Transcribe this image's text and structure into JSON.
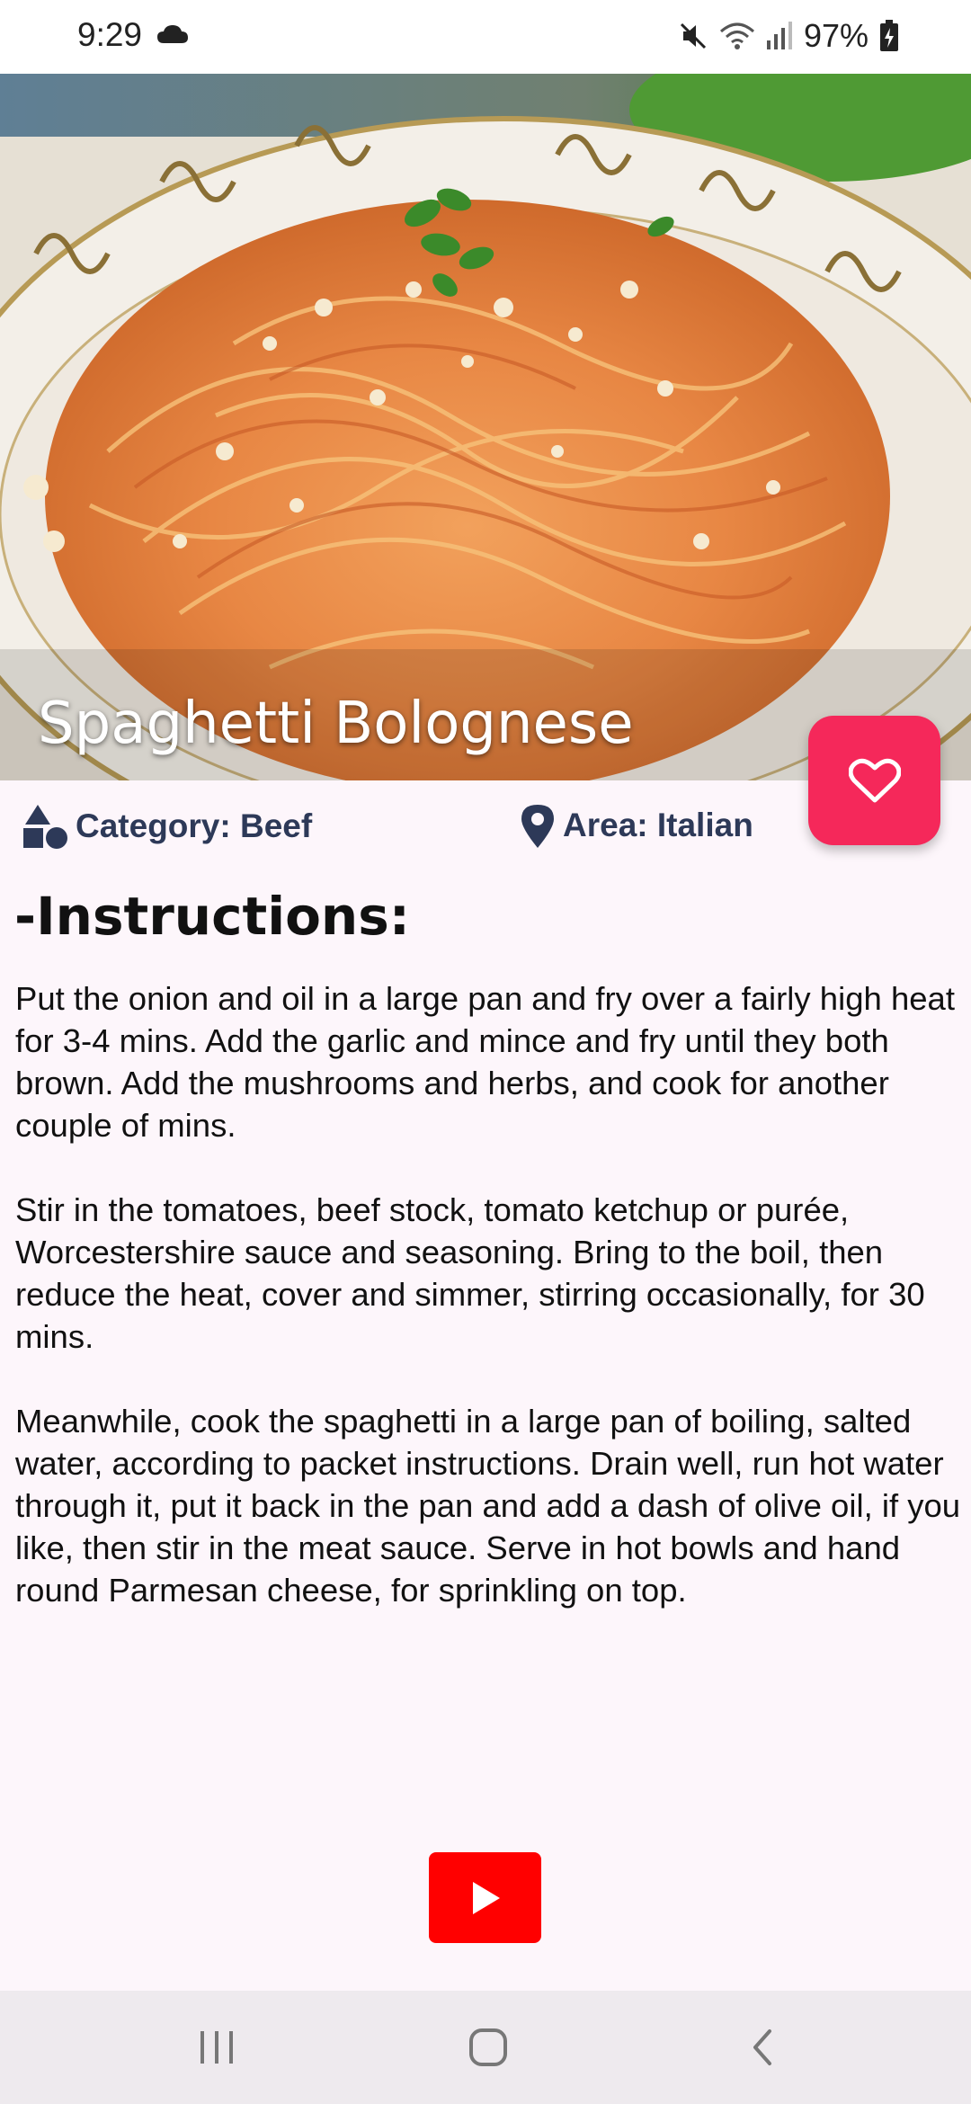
{
  "status_bar": {
    "time": "9:29",
    "battery": "97%",
    "icons": [
      "cloud-icon",
      "mute-icon",
      "wifi-icon",
      "signal-icon",
      "battery-icon"
    ]
  },
  "recipe": {
    "title": "Spaghetti Bolognese",
    "category": "Category: Beef",
    "area": "Area: Italian",
    "instructions_heading": "-Instructions:",
    "instructions": [
      "Put the onion and oil in a large pan and fry over a fairly high heat for 3-4 mins. Add the garlic and mince and fry until they both brown. Add the mushrooms and herbs, and cook for another couple of mins.",
      "Stir in the tomatoes, beef stock, tomato ketchup or purée, Worcestershire sauce and seasoning. Bring to the boil, then reduce the heat, cover and simmer, stirring occasionally, for 30 mins.",
      "Meanwhile, cook the spaghetti in a large pan of boiling, salted water, according to packet instructions. Drain well, run hot water through it, put it back in the pan and add a dash of olive oil, if you like, then stir in the meat sauce. Serve in hot bowls and hand round Parmesan cheese, for sprinkling on top."
    ]
  },
  "colors": {
    "favorite_button": "#f5285a",
    "meta_text": "#2d3958",
    "youtube": "#ff0000",
    "background": "#fdf6fb"
  }
}
